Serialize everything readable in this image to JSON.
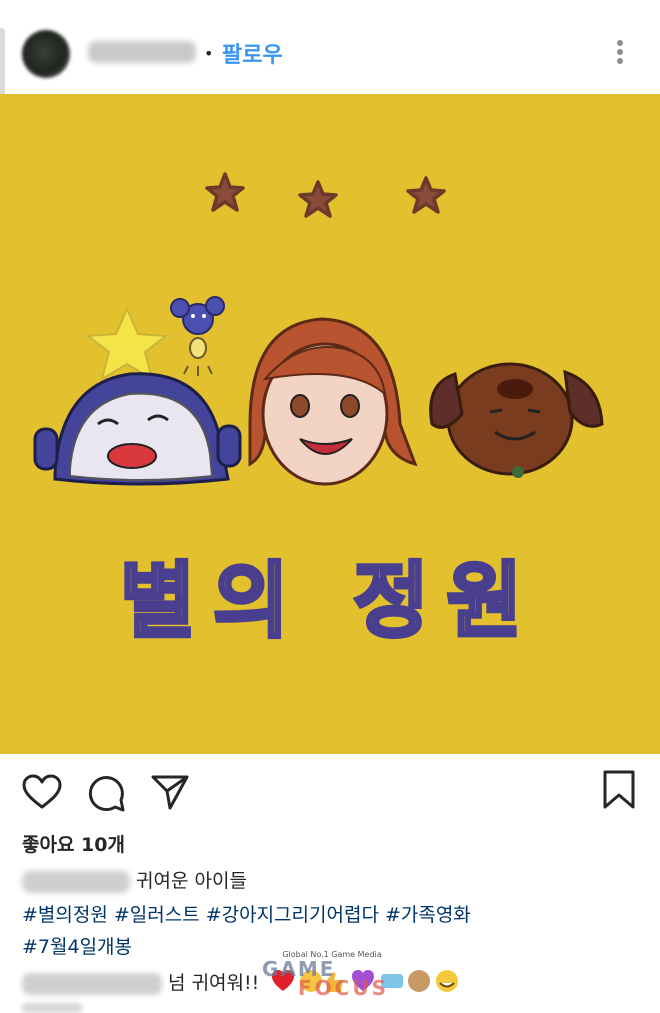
{
  "header": {
    "follow_label": "팔로우",
    "separator": "•"
  },
  "post": {
    "image_title": "별의 정원"
  },
  "likes": {
    "label": "좋아요 10개"
  },
  "caption": {
    "text": "귀여운 아이들",
    "hashtags": [
      "#별의정원",
      "#일러스트",
      "#강아지그리기어렵다",
      "#가족영화",
      "#7월4일개봉"
    ]
  },
  "comment": {
    "text": "넘 귀여워!!"
  },
  "watermark": {
    "tagline": "Global No.1 Game Media",
    "brand_top": "GAME",
    "brand_bottom": "FOCUS"
  },
  "colors": {
    "accent_blue": "#3897f0",
    "hashtag_blue": "#003569",
    "image_background": "#e3c12e",
    "drawing_ink": "#4a3f8f"
  },
  "icons": [
    "more-vertical-icon",
    "heart-icon",
    "comment-icon",
    "share-icon",
    "bookmark-icon"
  ]
}
